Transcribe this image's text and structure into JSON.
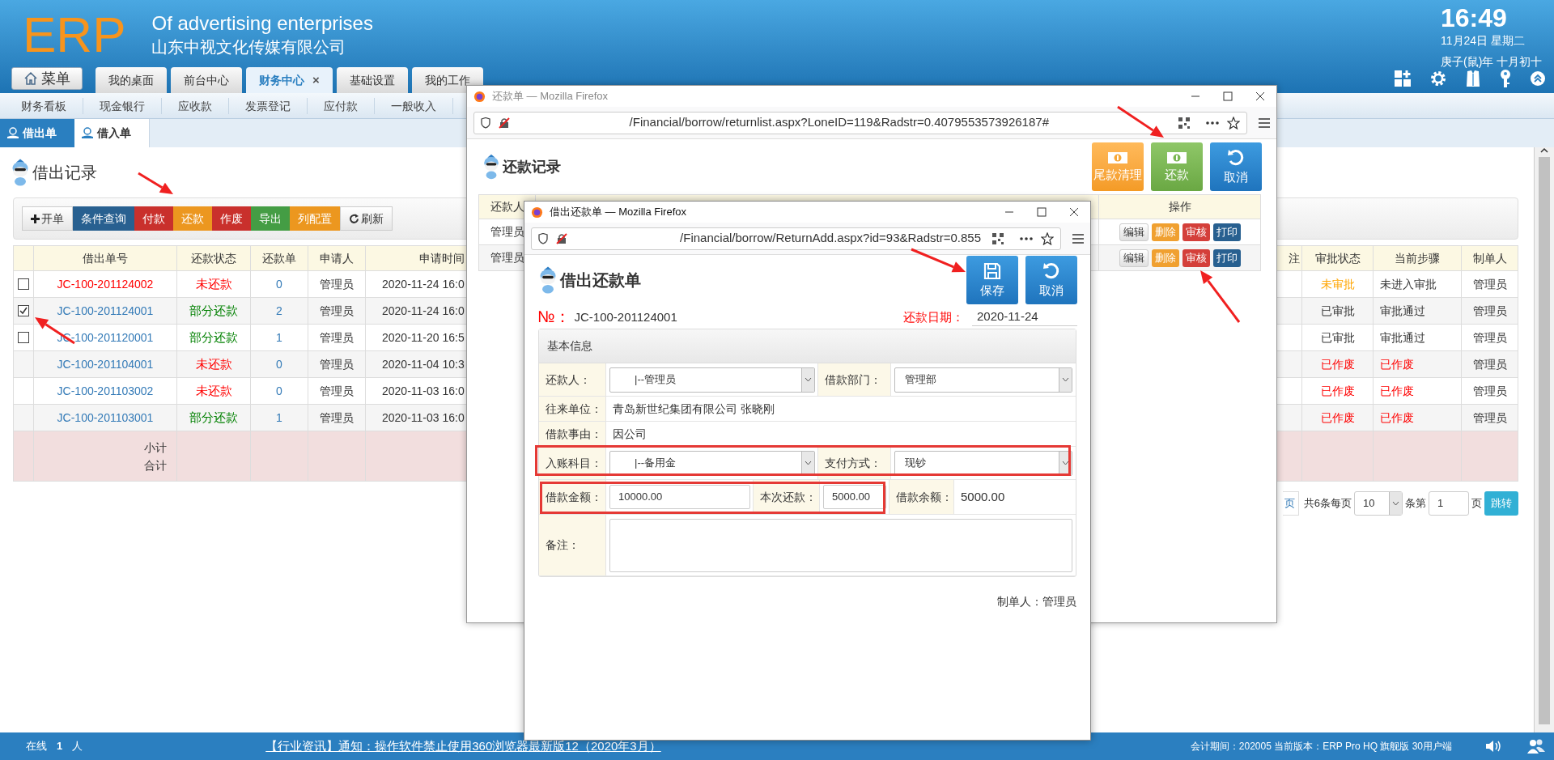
{
  "header": {
    "logo": "ERP",
    "tagline": "Of advertising enterprises",
    "company": "山东中视文化传媒有限公司"
  },
  "clock": {
    "time": "16:49",
    "date": "11月24日 星期二",
    "lunar": "庚子(鼠)年 十月初十"
  },
  "menu_button": "菜单",
  "tabs": [
    {
      "label": "我的桌面",
      "selected": false
    },
    {
      "label": "前台中心",
      "selected": false
    },
    {
      "label": "财务中心",
      "selected": true,
      "close": "×"
    },
    {
      "label": "基础设置",
      "selected": false
    },
    {
      "label": "我的工作",
      "selected": false
    }
  ],
  "subnav": [
    "财务看板",
    "现金银行",
    "应收款",
    "发票登记",
    "应付款",
    "一般收入"
  ],
  "page_tabs": [
    {
      "label": "借出单",
      "selected": true
    },
    {
      "label": "借入单",
      "selected": false
    }
  ],
  "list": {
    "title": "借出记录",
    "toolbar": [
      {
        "label": "开单",
        "kind": "add"
      },
      {
        "label": "条件查询",
        "kind": "primary"
      },
      {
        "label": "付款",
        "kind": "danger"
      },
      {
        "label": "还款",
        "kind": "warning"
      },
      {
        "label": "作废",
        "kind": "danger"
      },
      {
        "label": "导出",
        "kind": "success"
      },
      {
        "label": "列配置",
        "kind": "warning"
      },
      {
        "label": "刷新",
        "kind": "refresh"
      }
    ],
    "columns": [
      "借出单号",
      "还款状态",
      "还款单",
      "申请人",
      "申请时间",
      "注",
      "审批状态",
      "当前步骤",
      "制单人"
    ],
    "rows": [
      {
        "kind": "open",
        "checked": false,
        "number": {
          "text": "JC-100-201124002",
          "color": "#ff0000"
        },
        "status": {
          "text": "未还款",
          "color": "#ff0000"
        },
        "returns": "0",
        "applicant": "管理员",
        "time": "2020-11-24 16:0",
        "approval": {
          "text": "未审批",
          "color": "#ffa500"
        },
        "step": {
          "text": "未进入审批",
          "color": "#333333"
        },
        "maker": "管理员"
      },
      {
        "kind": "open",
        "checked": true,
        "number": {
          "text": "JC-100-201124001",
          "color": "#337ab7"
        },
        "status": {
          "text": "部分还款",
          "color": "#008000"
        },
        "returns": "2",
        "applicant": "管理员",
        "time": "2020-11-24 16:0",
        "approval": {
          "text": "已审批",
          "color": "#333333"
        },
        "step": {
          "text": "审批通过",
          "color": "#333333"
        },
        "maker": "管理员"
      },
      {
        "kind": "open",
        "checked": false,
        "number": {
          "text": "JC-100-201120001",
          "color": "#337ab7"
        },
        "status": {
          "text": "部分还款",
          "color": "#008000"
        },
        "returns": "1",
        "applicant": "管理员",
        "time": "2020-11-20 16:5",
        "approval": {
          "text": "已审批",
          "color": "#333333"
        },
        "step": {
          "text": "审批通过",
          "color": "#333333"
        },
        "maker": "管理员"
      },
      {
        "kind": "voided",
        "number": {
          "text": "JC-100-201104001",
          "color": "#337ab7"
        },
        "status": {
          "text": "未还款",
          "color": "#ff0000"
        },
        "returns": "0",
        "applicant": "管理员",
        "time": "2020-11-04 10:3",
        "approval": {
          "text": "已作废",
          "color": "#ff0000"
        },
        "step": {
          "text": "已作废",
          "color": "#ff0000"
        },
        "maker": "管理员"
      },
      {
        "kind": "voided",
        "number": {
          "text": "JC-100-201103002",
          "color": "#337ab7"
        },
        "status": {
          "text": "未还款",
          "color": "#ff0000"
        },
        "returns": "0",
        "applicant": "管理员",
        "time": "2020-11-03 16:0",
        "approval": {
          "text": "已作废",
          "color": "#ff0000"
        },
        "step": {
          "text": "已作废",
          "color": "#ff0000"
        },
        "maker": "管理员"
      },
      {
        "kind": "voided",
        "number": {
          "text": "JC-100-201103001",
          "color": "#337ab7"
        },
        "status": {
          "text": "部分还款",
          "color": "#008000"
        },
        "returns": "1",
        "applicant": "管理员",
        "time": "2020-11-03 16:0",
        "approval": {
          "text": "已作废",
          "color": "#ff0000"
        },
        "step": {
          "text": "已作废",
          "color": "#ff0000"
        },
        "maker": "管理员"
      }
    ],
    "totals": [
      "小计",
      "合计"
    ],
    "pager": {
      "last": "页",
      "total": "共6条每页",
      "size": "10",
      "of": "条第",
      "page": "1",
      "unit": "页",
      "go": "跳转"
    }
  },
  "status_bar": {
    "online_label": "在线",
    "online_count": "1",
    "online_unit": "人",
    "notice": "【行业资讯】通知：操作软件禁止使用360浏览器最新版12（2020年3月）",
    "version": "会计期间：202005 当前版本：ERP Pro HQ 旗舰版 30用户端"
  },
  "windows": [
    {
      "title": "还款单 — Mozilla Firefox",
      "active": false,
      "url": "/Financial/borrow/returnlist.aspx?LoneID=119&Radstr=0.4079553573926187#",
      "heading": "还款记录",
      "buttons": [
        {
          "label": "尾款清理",
          "kind": "clear"
        },
        {
          "label": "还款",
          "kind": "repay"
        },
        {
          "label": "取消",
          "kind": "cancel"
        }
      ],
      "columns": [
        "还款人",
        "操作"
      ],
      "rows": [
        {
          "payer": "管理员",
          "actions": [
            {
              "label": "编辑",
              "kind": "default"
            },
            {
              "label": "删除",
              "kind": "warning"
            },
            {
              "label": "审核",
              "kind": "danger"
            },
            {
              "label": "打印",
              "kind": "primary"
            }
          ]
        },
        {
          "payer": "管理员",
          "actions": [
            {
              "label": "编辑",
              "kind": "default"
            },
            {
              "label": "删除",
              "kind": "warning"
            },
            {
              "label": "审核",
              "kind": "danger"
            },
            {
              "label": "打印",
              "kind": "primary"
            }
          ]
        }
      ]
    },
    {
      "title": "借出还款单 — Mozilla Firefox",
      "active": true,
      "url": "/Financial/borrow/ReturnAdd.aspx?id=93&Radstr=0.855",
      "heading": "借出还款单",
      "buttons": [
        {
          "label": "保存",
          "kind": "save"
        },
        {
          "label": "取消",
          "kind": "cancel"
        }
      ],
      "number_label": "№：",
      "number": "JC-100-201124001",
      "date_label": "还款日期：",
      "date": "2020-11-24",
      "section": "基本信息",
      "form": [
        {
          "kind": "select2",
          "label": "还款人：",
          "value": "|--管理员",
          "label2": "借款部门：",
          "value2": "管理部"
        },
        {
          "kind": "text",
          "label": "往来单位：",
          "value": "青岛新世纪集团有限公司 张晓刚"
        },
        {
          "kind": "text",
          "label": "借款事由：",
          "value": "因公司"
        },
        {
          "kind": "select2",
          "label": "入账科目：",
          "value": "|--备用金",
          "label2": "支付方式：",
          "value2": "现钞"
        },
        {
          "kind": "amounts",
          "label": "借款金额：",
          "value": "10000.00",
          "label2": "本次还款：",
          "value2": "5000.00",
          "label3": "借款余额：",
          "value3": "5000.00"
        },
        {
          "kind": "textarea",
          "label": "备注："
        }
      ],
      "maker": "制单人：管理员"
    }
  ]
}
